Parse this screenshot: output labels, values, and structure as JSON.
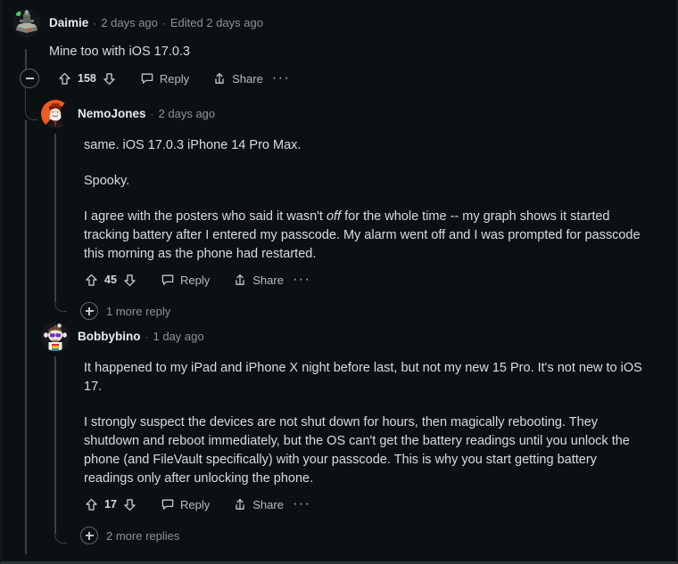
{
  "thread": {
    "comments": [
      {
        "id": "daimie",
        "author": "Daimie",
        "separator": "·",
        "timestamp": "2 days ago",
        "edited": "Edited 2 days ago",
        "paragraphs": [
          "Mine too with iOS 17.0.3"
        ],
        "score": "158",
        "reply_label": "Reply",
        "share_label": "Share",
        "more_options_label": "···",
        "avatar_type": "dark-ship-avatar"
      },
      {
        "id": "nemojones",
        "author": "NemoJones",
        "separator": "·",
        "timestamp": "2 days ago",
        "paragraphs": [
          "same. iOS 17.0.3 iPhone 14 Pro Max.",
          "Spooky."
        ],
        "rich_paragraph": {
          "before": "I agree with the posters who said it wasn't ",
          "italic": "off",
          "after": " for the whole time -- my graph shows it started tracking battery after I entered my passcode. My alarm went off and I was prompted for passcode this morning as the phone had restarted."
        },
        "score": "45",
        "reply_label": "Reply",
        "share_label": "Share",
        "more_options_label": "···",
        "more_replies_label": "1 more reply",
        "avatar_type": "orange-character-avatar"
      },
      {
        "id": "bobbybino",
        "author": "Bobbybino",
        "separator": "·",
        "timestamp": "1 day ago",
        "paragraphs": [
          "It happened to my iPad and iPhone X night before last, but not my new 15 Pro. It's not new to iOS 17.",
          "I strongly suspect the devices are not shut down for hours, then magically rebooting. They shutdown and reboot immediately, but the OS can't get the battery readings until you unlock the phone (and FileVault specifically) with your passcode. This is why you start getting battery readings only after unlocking the phone."
        ],
        "score": "17",
        "reply_label": "Reply",
        "share_label": "Share",
        "more_options_label": "···",
        "more_replies_label": "2 more replies",
        "avatar_type": "snoo-rainbow-avatar"
      }
    ]
  },
  "icons": {
    "upvote": "upvote-arrow-icon",
    "downvote": "downvote-arrow-icon",
    "reply": "speech-bubble-icon",
    "share": "share-upload-icon",
    "collapse": "minus-circle-icon",
    "expand": "plus-circle-icon"
  },
  "colors": {
    "background": "#0b1113",
    "text": "#d9dcde",
    "muted": "#8d9295",
    "thread_line": "#3a4245",
    "online_dot": "#46d160"
  }
}
